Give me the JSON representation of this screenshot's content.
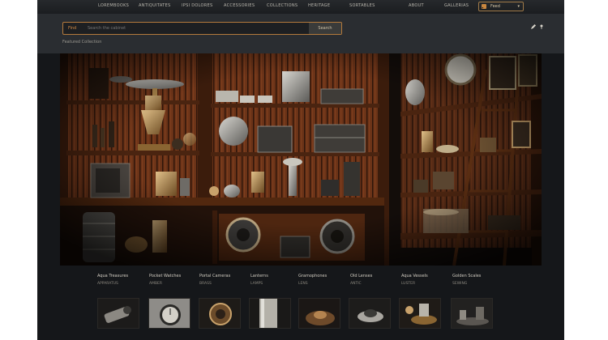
{
  "nav": {
    "items": [
      "Lorembooks",
      "Antiquitates",
      "Ipsi Dolores",
      "Accessories",
      "Collections",
      "Heritage",
      "Sortables",
      "About",
      "Gallerias"
    ],
    "rss_label": "Feed"
  },
  "search": {
    "label": "Find",
    "placeholder": "Search the cabinet",
    "button_label": "Search"
  },
  "breadcrumb": "Featured Collection",
  "categories": [
    {
      "title": "Aqua Treasures",
      "sub": "Apparatus"
    },
    {
      "title": "Pocket Watches",
      "sub": "Amber"
    },
    {
      "title": "Portal Cameras",
      "sub": "Brass"
    },
    {
      "title": "Lanterns",
      "sub": "Lamps"
    },
    {
      "title": "Gramophones",
      "sub": "Lens"
    },
    {
      "title": "Old Lenses",
      "sub": "Antic"
    },
    {
      "title": "Aqua Vessels",
      "sub": "Luster"
    },
    {
      "title": "Golden Scales",
      "sub": "Sewing"
    }
  ],
  "colors": {
    "accent": "#b47a3c",
    "wood": "#6e3418",
    "background": "#15171a"
  }
}
